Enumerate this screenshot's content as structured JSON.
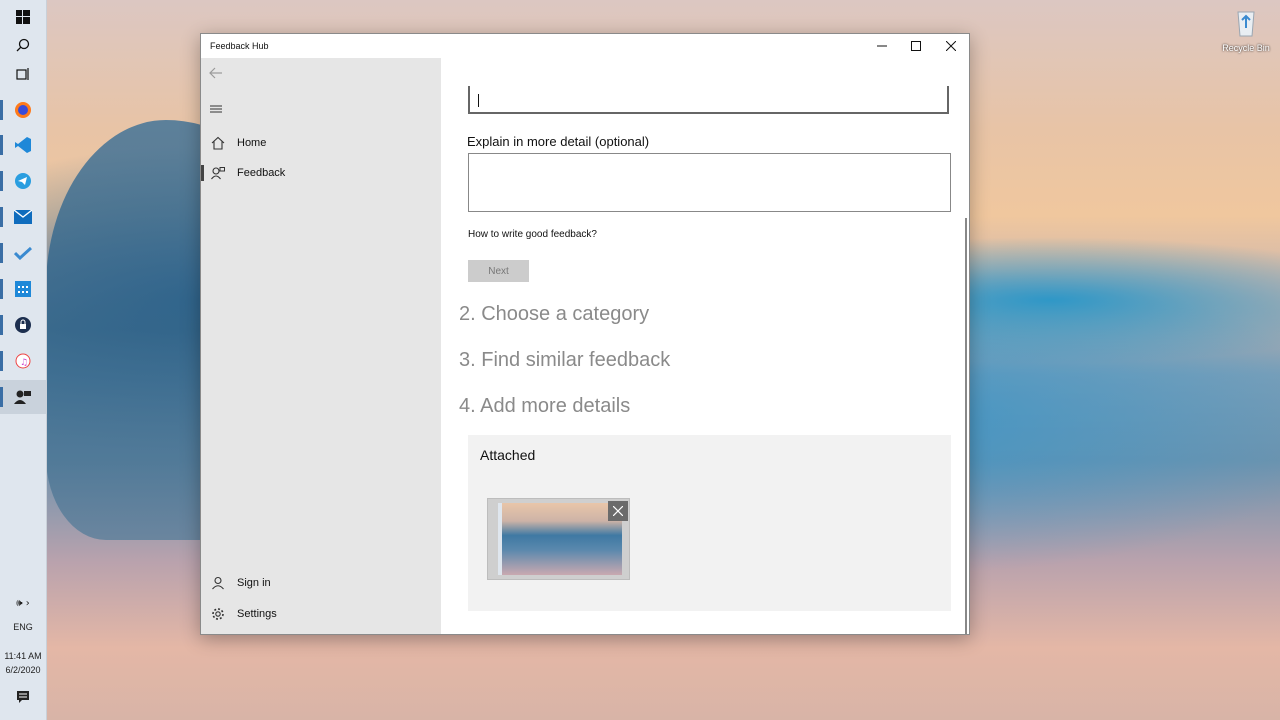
{
  "window": {
    "title": "Feedback Hub"
  },
  "sidebar": {
    "items": [
      {
        "label": "Home",
        "icon": "home-icon"
      },
      {
        "label": "Feedback",
        "icon": "feedback-icon"
      }
    ],
    "bottom_items": [
      {
        "label": "Sign in",
        "icon": "person-icon"
      },
      {
        "label": "Settings",
        "icon": "gear-icon"
      }
    ]
  },
  "form": {
    "summary_value": "",
    "detail_label": "Explain in more detail (optional)",
    "detail_value": "",
    "help_link": "How to write good feedback?",
    "next_label": "Next"
  },
  "steps": [
    "2. Choose a category",
    "3. Find similar feedback",
    "4. Add more details"
  ],
  "attachments": {
    "title": "Attached"
  },
  "taskbar": {
    "language": "ENG",
    "time": "11:41 AM",
    "date": "6/2/2020"
  },
  "desktop": {
    "recycle_bin_label": "Recycle Bin"
  },
  "colors": {
    "accent": "#3a6ea5",
    "sidebar_bg": "#e6e6e6",
    "step_text": "#8a8a8a"
  }
}
